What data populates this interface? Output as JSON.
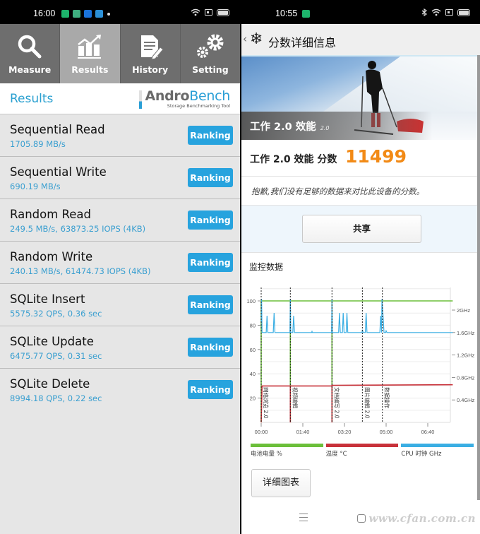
{
  "left": {
    "status_bar": {
      "time": "16:00",
      "app_icons": [
        {
          "name": "app-notification-icon-1",
          "color": "#1db56c"
        },
        {
          "name": "app-notification-icon-2",
          "color": "#3fae7f"
        },
        {
          "name": "app-notification-icon-3",
          "color": "#1a73d9"
        },
        {
          "name": "app-notification-icon-4",
          "color": "#2b8fd6"
        }
      ]
    },
    "tabs": [
      {
        "label": "Measure",
        "icon": "search-icon",
        "active": false
      },
      {
        "label": "Results",
        "icon": "bar-chart-icon",
        "active": true
      },
      {
        "label": "History",
        "icon": "document-edit-icon",
        "active": false
      },
      {
        "label": "Setting",
        "icon": "gears-icon",
        "active": false
      }
    ],
    "results_title": "Results",
    "logo": {
      "andro": "Andro",
      "bench": "Bench",
      "subtitle": "Storage Benchmarking Tool"
    },
    "ranking_label": "Ranking",
    "results": [
      {
        "title": "Sequential Read",
        "value": "1705.89 MB/s"
      },
      {
        "title": "Sequential Write",
        "value": "690.19 MB/s"
      },
      {
        "title": "Random Read",
        "value": "249.5 MB/s, 63873.25 IOPS (4KB)"
      },
      {
        "title": "Random Write",
        "value": "240.13 MB/s, 61474.73 IOPS (4KB)"
      },
      {
        "title": "SQLite Insert",
        "value": "5575.32 QPS, 0.36 sec"
      },
      {
        "title": "SQLite Update",
        "value": "6475.77 QPS, 0.31 sec"
      },
      {
        "title": "SQLite Delete",
        "value": "8994.18 QPS, 0.22 sec"
      }
    ]
  },
  "right": {
    "status_bar": {
      "time": "10:55"
    },
    "header": {
      "back": "‹",
      "title": "分数详细信息"
    },
    "hero": {
      "caption": "工作 2.0 效能",
      "version": "2.0"
    },
    "score": {
      "label": "工作 2.0 效能 分数",
      "value": "11499"
    },
    "sorry_text": "抱歉,我们没有足够的数据来对比此设备的分数。",
    "share_label": "共享",
    "monitor_title": "监控数据",
    "legend": [
      {
        "label": "电池电量 %",
        "color": "#6cbf3a"
      },
      {
        "label": "温度 °C",
        "color": "#c8323a"
      },
      {
        "label": "CPU 时钟 GHz",
        "color": "#3aaee3"
      }
    ],
    "detail_label": "详细图表",
    "watermark": "www.cfan.com.cn"
  },
  "chart_data": {
    "type": "line",
    "title": "监控数据",
    "xlabel": "",
    "x_ticks": [
      "00:00",
      "01:40",
      "03:20",
      "05:00",
      "06:40"
    ],
    "x_range_sec": [
      0,
      460
    ],
    "left_axis": {
      "ticks": [
        20,
        40,
        60,
        80,
        100
      ],
      "range": [
        0,
        110
      ]
    },
    "right_axis": {
      "ticks": [
        "0.4GHz",
        "0.8GHz",
        "1.2GHz",
        "1.6GHz",
        "2GHz"
      ],
      "range_ghz": [
        0,
        2.5
      ]
    },
    "events": [
      {
        "label": "网络浏览 2.0",
        "t": 0
      },
      {
        "label": "视频编辑",
        "t": 70
      },
      {
        "label": "文档编写 2.0",
        "t": 170
      },
      {
        "label": "图片编辑 2.0",
        "t": 243
      },
      {
        "label": "数据操作",
        "t": 291
      }
    ],
    "series": [
      {
        "name": "电池电量 %",
        "axis": "left",
        "color": "#6cbf3a",
        "points": [
          [
            0,
            0
          ],
          [
            0,
            100
          ],
          [
            70,
            100
          ],
          [
            70,
            0
          ],
          [
            70,
            100
          ],
          [
            170,
            100
          ],
          [
            170,
            0
          ],
          [
            170,
            100
          ],
          [
            460,
            100
          ]
        ]
      },
      {
        "name": "温度 °C",
        "axis": "left",
        "color": "#c8323a",
        "points": [
          [
            0,
            0
          ],
          [
            2,
            30
          ],
          [
            70,
            30
          ],
          [
            70,
            0
          ],
          [
            70,
            30
          ],
          [
            170,
            30
          ],
          [
            170,
            0
          ],
          [
            170,
            30.5
          ],
          [
            460,
            31
          ]
        ]
      },
      {
        "name": "CPU 时钟 GHz",
        "axis": "right",
        "color": "#3aaee3",
        "points": [
          [
            0,
            1.8
          ],
          [
            1,
            2.2
          ],
          [
            2,
            1.6
          ],
          [
            12,
            1.6
          ],
          [
            14,
            1.9
          ],
          [
            16,
            1.6
          ],
          [
            29,
            1.6
          ],
          [
            31,
            1.95
          ],
          [
            33,
            1.6
          ],
          [
            69,
            1.6
          ],
          [
            70,
            2.2
          ],
          [
            71,
            1.6
          ],
          [
            76,
            1.6
          ],
          [
            78,
            1.9
          ],
          [
            80,
            1.6
          ],
          [
            121,
            1.6
          ],
          [
            122,
            1.62
          ],
          [
            123,
            1.6
          ],
          [
            169,
            1.6
          ],
          [
            170,
            2.2
          ],
          [
            171,
            1.6
          ],
          [
            186,
            1.6
          ],
          [
            188,
            1.95
          ],
          [
            190,
            1.6
          ],
          [
            195,
            1.6
          ],
          [
            197,
            1.95
          ],
          [
            199,
            1.6
          ],
          [
            204,
            1.6
          ],
          [
            206,
            1.95
          ],
          [
            208,
            1.6
          ],
          [
            242,
            1.6
          ],
          [
            243,
            1.65
          ],
          [
            245,
            1.6
          ],
          [
            250,
            1.6
          ],
          [
            252,
            1.95
          ],
          [
            254,
            1.6
          ],
          [
            285,
            1.6
          ],
          [
            287,
            1.9
          ],
          [
            289,
            1.6
          ],
          [
            290,
            2.2
          ],
          [
            293,
            1.85
          ],
          [
            295,
            1.6
          ],
          [
            299,
            1.6
          ],
          [
            300,
            1.63
          ],
          [
            302,
            1.6
          ],
          [
            460,
            1.6
          ]
        ]
      }
    ],
    "grid": true
  }
}
